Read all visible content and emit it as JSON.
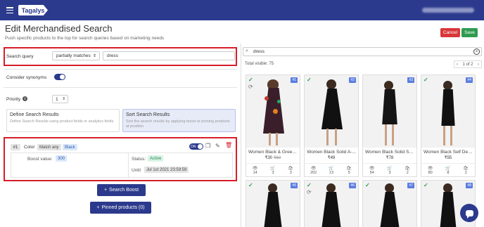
{
  "topbar": {
    "brand": "Tagalys"
  },
  "header": {
    "title": "Edit Merchandised Search",
    "subtitle": "Push specific products to the top for search queries based on marketing needs",
    "cancel_label": "Cancel",
    "save_label": "Save"
  },
  "search_query": {
    "label": "Search query",
    "match_type": "partially matches",
    "value": "dress"
  },
  "synonyms": {
    "label": "Consider synonyms",
    "enabled": true
  },
  "priority": {
    "label": "Priority",
    "value": "1"
  },
  "modes": {
    "define": {
      "title": "Define Search Results",
      "desc": "Define Search Results using product fields or analytics fields"
    },
    "sort": {
      "title": "Sort Search Results",
      "desc": "Sort the search results by applying boost or pinning products at position"
    }
  },
  "boost_rule": {
    "number": "#1",
    "field": "Color",
    "match": "Match any",
    "value": "Black",
    "toggle": "ON",
    "boost_label": "Boost value:",
    "boost_value": "300",
    "status_label": "Status:",
    "status_value": "Active",
    "until_label": "Until",
    "until_value": "Jul 1st 2021 23:59:59"
  },
  "buttons": {
    "search_boost": "Search Boost",
    "pinned": "Pinned products (0)"
  },
  "preview": {
    "search_value": "dress",
    "total": "Total visible: 75",
    "page": "1 of 2",
    "products": [
      {
        "badge": "#1",
        "name": "Women Black & Green ...",
        "price": "₹30",
        "old_price": "₹60",
        "views": "14",
        "carts": "3",
        "sales": "3"
      },
      {
        "badge": "#2",
        "name": "Women Black Solid A-...",
        "price": "₹49",
        "old_price": "",
        "views": "202",
        "carts": "13",
        "sales": "5"
      },
      {
        "badge": "#3",
        "name": "Women Black Solid Sh...",
        "price": "₹78",
        "old_price": "",
        "views": "54",
        "carts": "3",
        "sales": "2"
      },
      {
        "badge": "#4",
        "name": "Women Black Self Des...",
        "price": "₹55",
        "old_price": "",
        "views": "80",
        "carts": "8",
        "sales": "2"
      },
      {
        "badge": "#5"
      },
      {
        "badge": "#6"
      },
      {
        "badge": "#7"
      },
      {
        "badge": "#8"
      }
    ]
  },
  "colors": {
    "primary": "#2b3a8c",
    "cancel": "#d9373a",
    "save": "#2f9b4f",
    "highlight": "#d71e2a"
  }
}
